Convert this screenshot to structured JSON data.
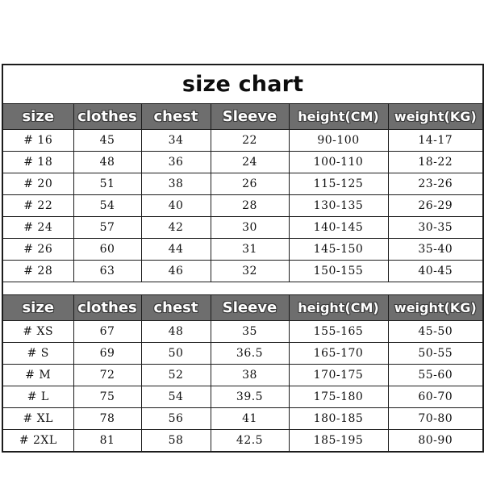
{
  "title": "size chart",
  "columns": [
    "size",
    "clothes",
    "chest",
    "Sleeve",
    "height(CM)",
    "weight(KG)"
  ],
  "colors": {
    "header_background": "#6e6e6e",
    "header_text": "#ffffff",
    "border": "#1c1c1c",
    "page_background": "#ffffff",
    "body_text": "#111111"
  },
  "tables": [
    {
      "name": "kids-size-table",
      "headers": [
        "size",
        "clothes",
        "chest",
        "Sleeve",
        "height(CM)",
        "weight(KG)"
      ],
      "rows": [
        [
          "#  16",
          "45",
          "34",
          "22",
          "90-100",
          "14-17"
        ],
        [
          "#  18",
          "48",
          "36",
          "24",
          "100-110",
          "18-22"
        ],
        [
          "#  20",
          "51",
          "38",
          "26",
          "115-125",
          "23-26"
        ],
        [
          "#  22",
          "54",
          "40",
          "28",
          "130-135",
          "26-29"
        ],
        [
          "#  24",
          "57",
          "42",
          "30",
          "140-145",
          "30-35"
        ],
        [
          "#  26",
          "60",
          "44",
          "31",
          "145-150",
          "35-40"
        ],
        [
          "#  28",
          "63",
          "46",
          "32",
          "150-155",
          "40-45"
        ]
      ]
    },
    {
      "name": "adult-size-table",
      "headers": [
        "size",
        "clothes",
        "chest",
        "Sleeve",
        "height(CM)",
        "weight(KG)"
      ],
      "rows": [
        [
          "#  XS",
          "67",
          "48",
          "35",
          "155-165",
          "45-50"
        ],
        [
          "#  S",
          "69",
          "50",
          "36.5",
          "165-170",
          "50-55"
        ],
        [
          "#  M",
          "72",
          "52",
          "38",
          "170-175",
          "55-60"
        ],
        [
          "#  L",
          "75",
          "54",
          "39.5",
          "175-180",
          "60-70"
        ],
        [
          "#  XL",
          "78",
          "56",
          "41",
          "180-185",
          "70-80"
        ],
        [
          "#  2XL",
          "81",
          "58",
          "42.5",
          "185-195",
          "80-90"
        ]
      ]
    }
  ]
}
